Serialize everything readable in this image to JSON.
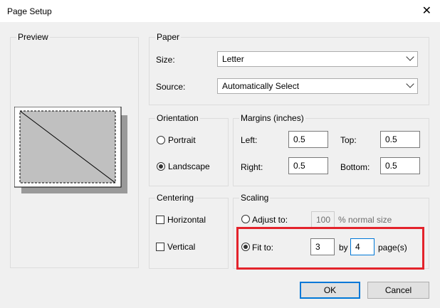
{
  "window": {
    "title": "Page Setup",
    "close_glyph": "✕"
  },
  "preview": {
    "label": "Preview"
  },
  "paper": {
    "label": "Paper",
    "size_label": "Size:",
    "size_value": "Letter",
    "source_label": "Source:",
    "source_value": "Automatically Select"
  },
  "orientation": {
    "label": "Orientation",
    "portrait": "Portrait",
    "landscape": "Landscape",
    "selected": "landscape"
  },
  "margins": {
    "label": "Margins (inches)",
    "left_label": "Left:",
    "left_value": "0.5",
    "right_label": "Right:",
    "right_value": "0.5",
    "top_label": "Top:",
    "top_value": "0.5",
    "bottom_label": "Bottom:",
    "bottom_value": "0.5"
  },
  "centering": {
    "label": "Centering",
    "horizontal": "Horizontal",
    "vertical": "Vertical"
  },
  "scaling": {
    "label": "Scaling",
    "adjust_to": "Adjust to:",
    "adjust_value": "100",
    "normal_size": "% normal size",
    "fit_to": "Fit to:",
    "fit_wide": "3",
    "by": "by",
    "fit_tall": "4",
    "pages": "page(s)",
    "selected": "fit"
  },
  "buttons": {
    "ok": "OK",
    "cancel": "Cancel"
  },
  "colors": {
    "highlight": "#e3232b",
    "focus": "#0078d7"
  }
}
